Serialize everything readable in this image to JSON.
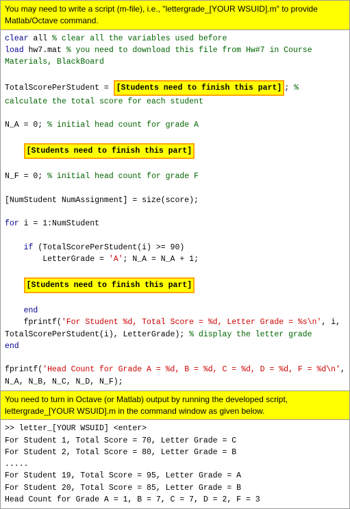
{
  "top_note": {
    "text": "You may need to write a script (m-file), i.e., \"lettergrade_[YOUR WSUID].m\" to provide Matlab/Octave command."
  },
  "code": {
    "lines": [
      {
        "type": "normal",
        "content": "clear all % clear all the variables used before"
      },
      {
        "type": "normal",
        "content": "load hw7.mat % you need to download this file from Hw#7 in Course Materials, BlackBoard"
      },
      {
        "type": "blank"
      },
      {
        "type": "highlight_line",
        "content": "TotalScorePerStudent = [Students need to finish this part]; % calculate the total score for each student"
      },
      {
        "type": "blank"
      },
      {
        "type": "normal",
        "content": "N_A = 0; % initial head count for grade A"
      },
      {
        "type": "blank"
      },
      {
        "type": "highlight_box",
        "content": "    [Students need to finish this part]"
      },
      {
        "type": "blank"
      },
      {
        "type": "normal",
        "content": "N_F = 0; % initial head count for grade F"
      },
      {
        "type": "blank"
      },
      {
        "type": "normal",
        "content": "[NumStudent NumAssignment] = size(score);"
      },
      {
        "type": "blank"
      },
      {
        "type": "normal",
        "content": "for i = 1:NumStudent"
      },
      {
        "type": "blank"
      },
      {
        "type": "normal",
        "content": "    if (TotalScorePerStudent(i) >= 90)"
      },
      {
        "type": "normal",
        "content": "        LetterGrade = 'A'; N_A = N_A + 1;"
      },
      {
        "type": "blank"
      },
      {
        "type": "highlight_box2",
        "content": "    [Students need to finish this part]"
      },
      {
        "type": "blank"
      },
      {
        "type": "normal",
        "content": "    end"
      },
      {
        "type": "normal",
        "content": "    fprintf('For Student %d, Total Score = %d, Letter Grade = %s\\n', i, TotalScorePerStudent(i), LetterGrade); % display the letter grade"
      },
      {
        "type": "normal",
        "content": "end"
      },
      {
        "type": "blank"
      },
      {
        "type": "normal",
        "content": "fprintf('Head Count for Grade A = %d, B = %d, C = %d, D = %d, F = %d\\n', N_A, N_B, N_C, N_D, N_F);"
      }
    ]
  },
  "bottom_note": {
    "text": "You need to turn in Octave (or Matlab) output by running the developed script, lettergrade_[YOUR WSUID].m in the command window as given below."
  },
  "output": {
    "lines": [
      ">> letter_[YOUR WSUID] <enter>",
      "For Student 1, Total Score = 70, Letter Grade = C",
      "For Student 2, Total Score = 80, Letter Grade = B",
      ".....",
      "For Student 19, Total Score = 95, Letter Grade = A",
      "For Student 20, Total Score = 85, Letter Grade = B",
      "Head Count for Grade A = 1, B = 7, C = 7, D = 2, F = 3"
    ]
  }
}
